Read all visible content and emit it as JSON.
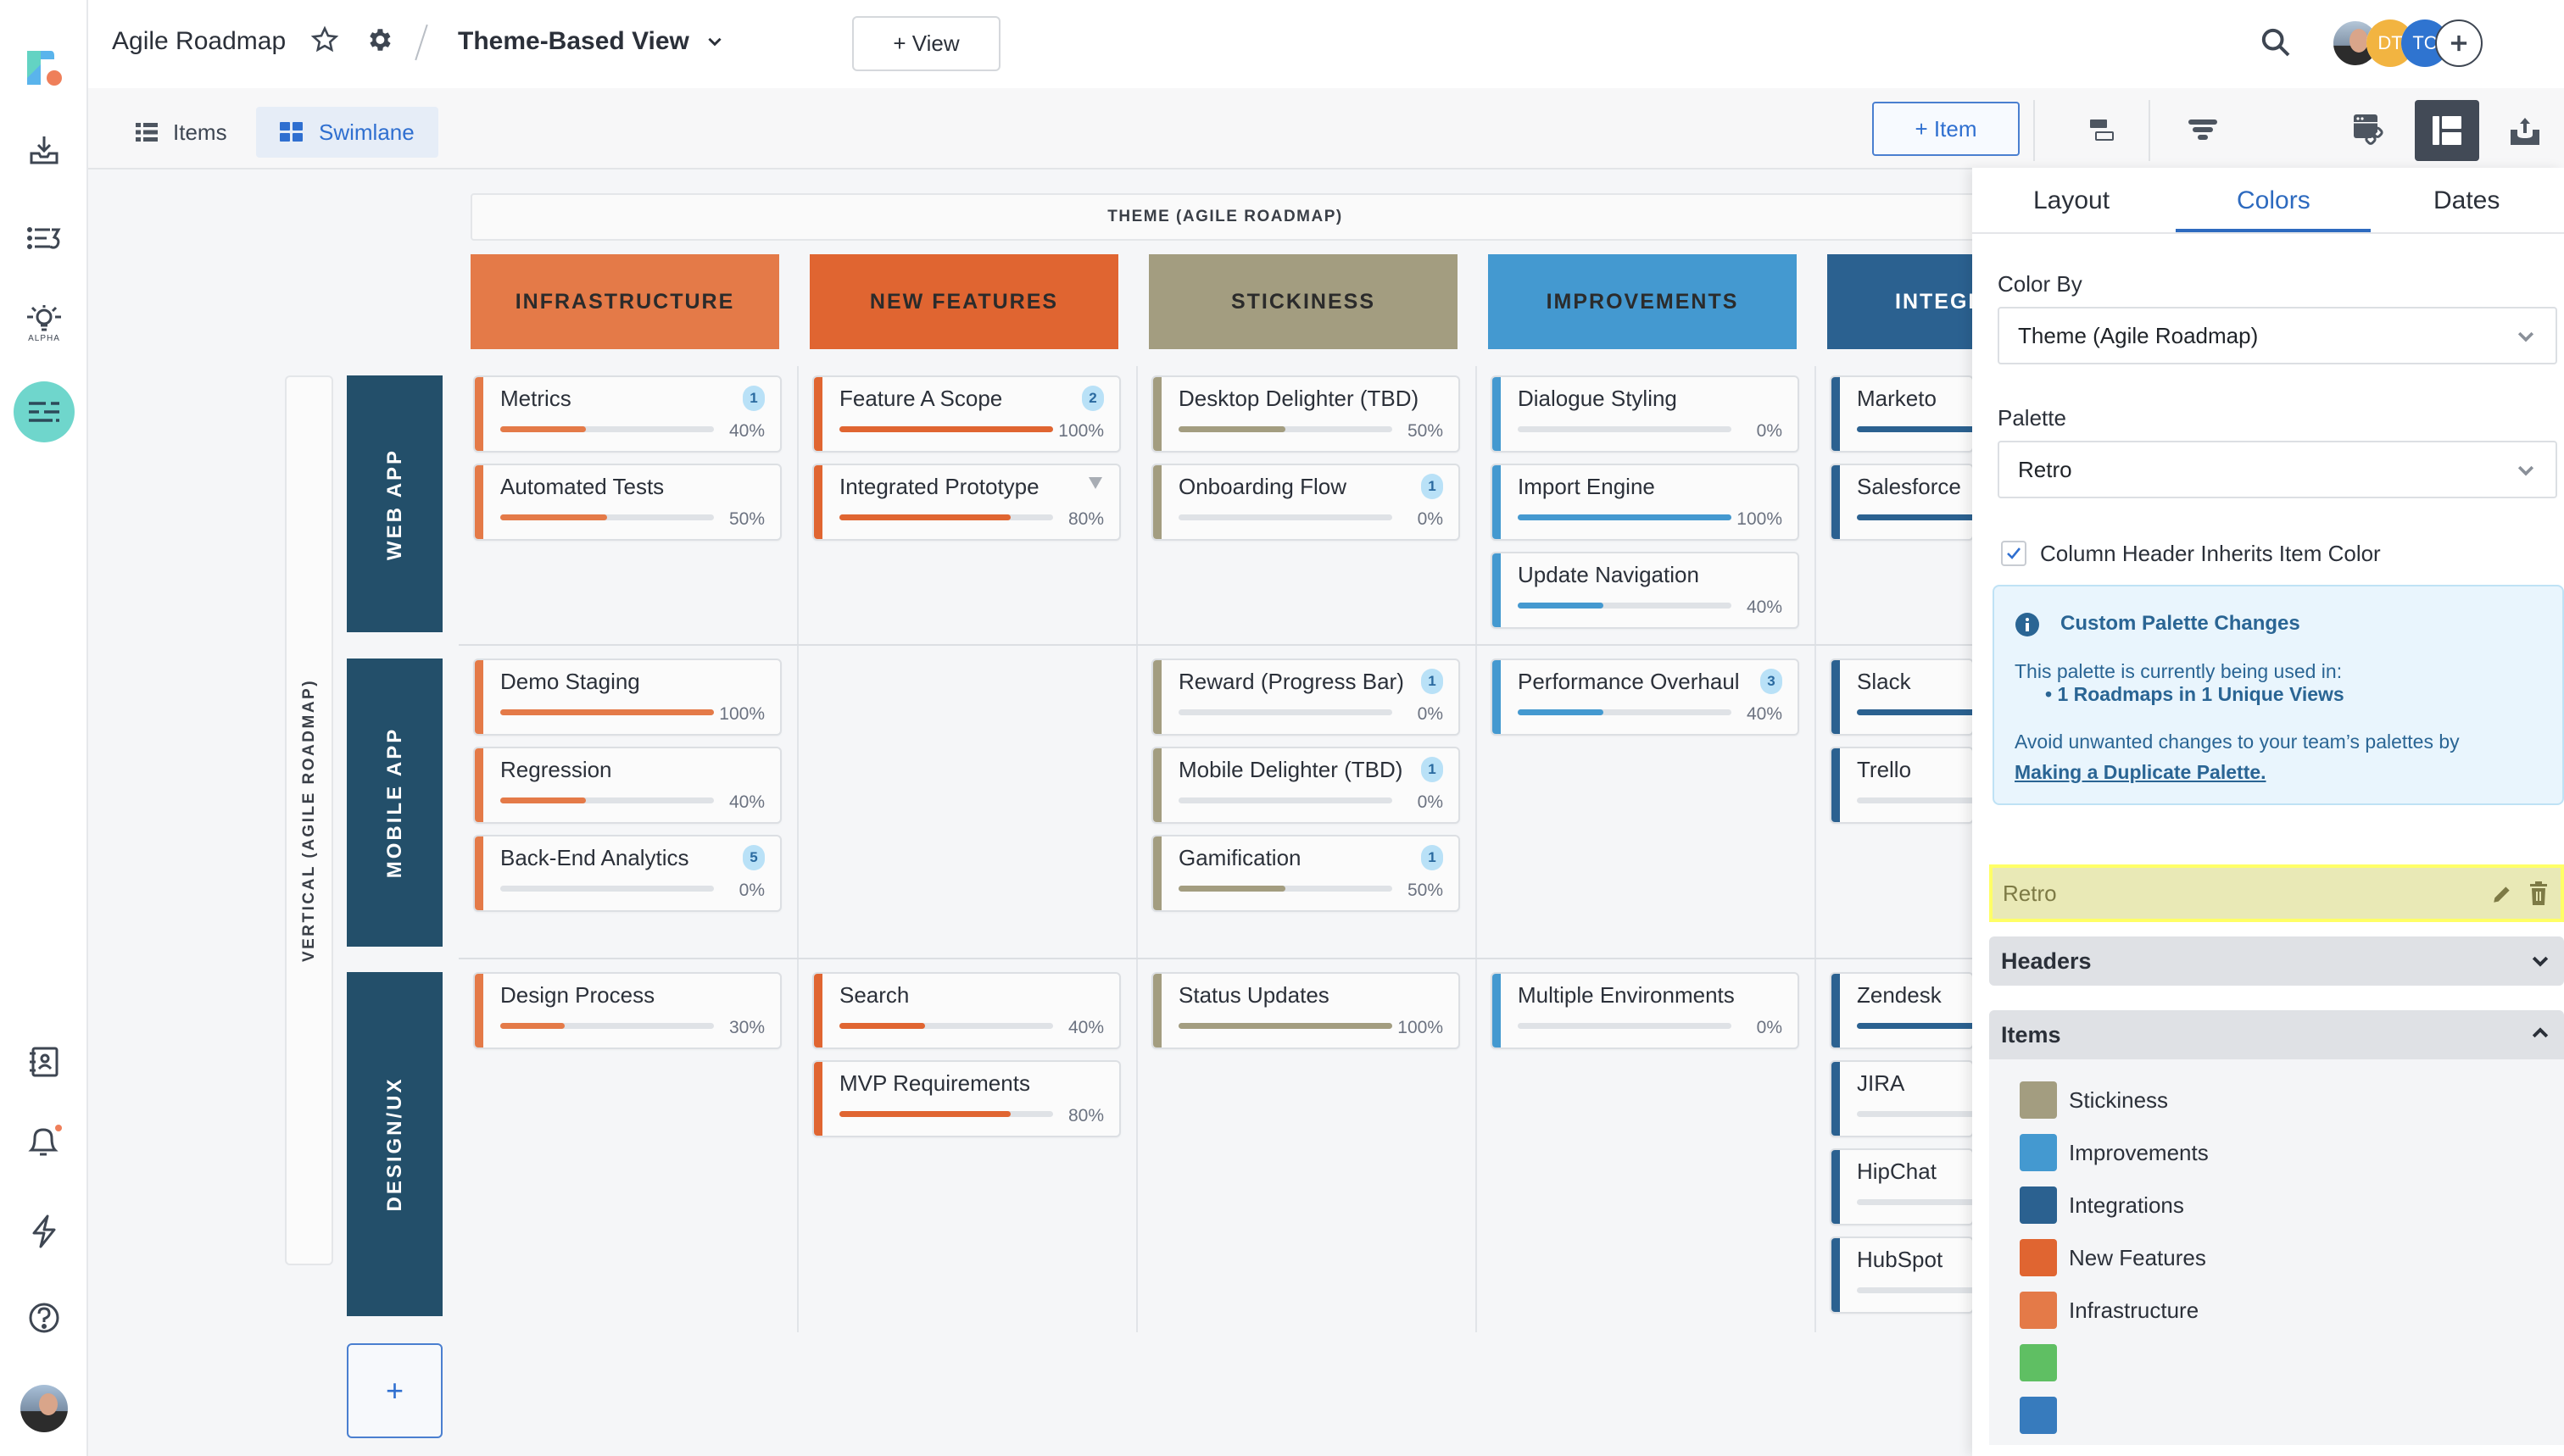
{
  "header": {
    "roadmap_title": "Agile Roadmap",
    "view_title": "Theme-Based View",
    "add_view_label": "+ View",
    "avatars": [
      {
        "initials": "",
        "color": "#6b7b8c",
        "kind": "photo"
      },
      {
        "initials": "DT",
        "color": "#f2b441"
      },
      {
        "initials": "TC",
        "color": "#2f74d0"
      }
    ]
  },
  "left_nav": {
    "items": [
      "logo",
      "inbox-download",
      "list-sort",
      "ideas-alpha",
      "roadmaps",
      "contacts",
      "notifications",
      "integrations",
      "help",
      "profile"
    ],
    "alpha_label": "ALPHA"
  },
  "toolbar": {
    "tabs": [
      {
        "label": "Items",
        "active": false
      },
      {
        "label": "Swimlane",
        "active": true
      }
    ],
    "add_item_label": "+ Item"
  },
  "board": {
    "column_axis_label": "THEME (AGILE ROADMAP)",
    "row_axis_label": "VERTICAL (AGILE ROADMAP)",
    "add_row_label": "+",
    "columns": [
      {
        "name": "INFRASTRUCTURE",
        "color": "#e47a48"
      },
      {
        "name": "NEW FEATURES",
        "color": "#e06531"
      },
      {
        "name": "STICKINESS",
        "color": "#a39d80"
      },
      {
        "name": "IMPROVEMENTS",
        "color": "#4499d0"
      },
      {
        "name": "INTEGRATIONS",
        "color": "#2b6190",
        "visible_label": "INTEGR"
      }
    ],
    "rows": [
      {
        "name": "WEB APP",
        "color": "#234f6a"
      },
      {
        "name": "MOBILE APP",
        "color": "#234f6a"
      },
      {
        "name": "DESIGN/UX",
        "color": "#234f6a"
      }
    ],
    "cells": [
      [
        [
          {
            "name": "Metrics",
            "progress": 40,
            "badge": "1"
          },
          {
            "name": "Automated Tests",
            "progress": 50
          }
        ],
        [
          {
            "name": "Feature A Scope",
            "progress": 100,
            "badge": "2"
          },
          {
            "name": "Integrated Prototype",
            "progress": 80,
            "flag": "triangle"
          }
        ],
        [
          {
            "name": "Desktop Delighter (TBD)",
            "progress": 50
          },
          {
            "name": "Onboarding Flow",
            "progress": 0,
            "badge": "1"
          }
        ],
        [
          {
            "name": "Dialogue Styling",
            "progress": 0
          },
          {
            "name": "Import Engine",
            "progress": 100
          },
          {
            "name": "Update Navigation",
            "progress": 40
          }
        ],
        [
          {
            "name": "Marketo",
            "progress": 100
          },
          {
            "name": "Salesforce",
            "progress": 100
          }
        ]
      ],
      [
        [
          {
            "name": "Demo Staging",
            "progress": 100
          },
          {
            "name": "Regression",
            "progress": 40
          },
          {
            "name": "Back-End Analytics",
            "progress": 0,
            "badge": "5"
          }
        ],
        [],
        [
          {
            "name": "Reward (Progress Bar)",
            "progress": 0,
            "badge": "1"
          },
          {
            "name": "Mobile Delighter (TBD)",
            "progress": 0,
            "badge": "1"
          },
          {
            "name": "Gamification",
            "progress": 50,
            "badge": "1"
          }
        ],
        [
          {
            "name": "Performance Overhaul",
            "progress": 40,
            "badge": "3"
          }
        ],
        [
          {
            "name": "Slack",
            "progress": 100
          },
          {
            "name": "Trello",
            "progress": 0
          }
        ]
      ],
      [
        [
          {
            "name": "Design Process",
            "progress": 30
          }
        ],
        [
          {
            "name": "Search",
            "progress": 40
          },
          {
            "name": "MVP Requirements",
            "progress": 80
          }
        ],
        [
          {
            "name": "Status Updates",
            "progress": 100
          }
        ],
        [
          {
            "name": "Multiple Environments",
            "progress": 0
          }
        ],
        [
          {
            "name": "Zendesk",
            "progress": 100
          },
          {
            "name": "JIRA",
            "progress": 0
          },
          {
            "name": "HipChat",
            "progress": 0
          },
          {
            "name": "HubSpot",
            "progress": 0
          }
        ]
      ]
    ]
  },
  "panel": {
    "tabs": [
      {
        "label": "Layout",
        "active": false
      },
      {
        "label": "Colors",
        "active": true
      },
      {
        "label": "Dates",
        "active": false
      }
    ],
    "color_by_label": "Color By",
    "color_by_value": "Theme (Agile Roadmap)",
    "palette_label": "Palette",
    "palette_value": "Retro",
    "inherit_checkbox_label": "Column Header Inherits Item Color",
    "inherit_checked": true,
    "info": {
      "title": "Custom Palette Changes",
      "used_in": "This palette is currently being used in:",
      "bullet": "• 1 Roadmaps in 1 Unique Views",
      "avoid": "Avoid unwanted changes to your team’s palettes by",
      "link": "Making a Duplicate Palette."
    },
    "palette_name": "Retro",
    "headers_label": "Headers",
    "items_label": "Items",
    "item_colors": [
      {
        "label": "Stickiness",
        "color": "#a39d80"
      },
      {
        "label": "Improvements",
        "color": "#4499d0"
      },
      {
        "label": "Integrations",
        "color": "#2b6190"
      },
      {
        "label": "New Features",
        "color": "#e06531"
      },
      {
        "label": "Infrastructure",
        "color": "#e47a48"
      },
      {
        "label": "",
        "color": "#5fbf63"
      },
      {
        "label": "",
        "color": "#377bbd"
      }
    ]
  },
  "colors": {
    "accent": "#2d6abf",
    "nav_active": "#6fd6cc",
    "notification_dot": "#ef7f5a"
  }
}
